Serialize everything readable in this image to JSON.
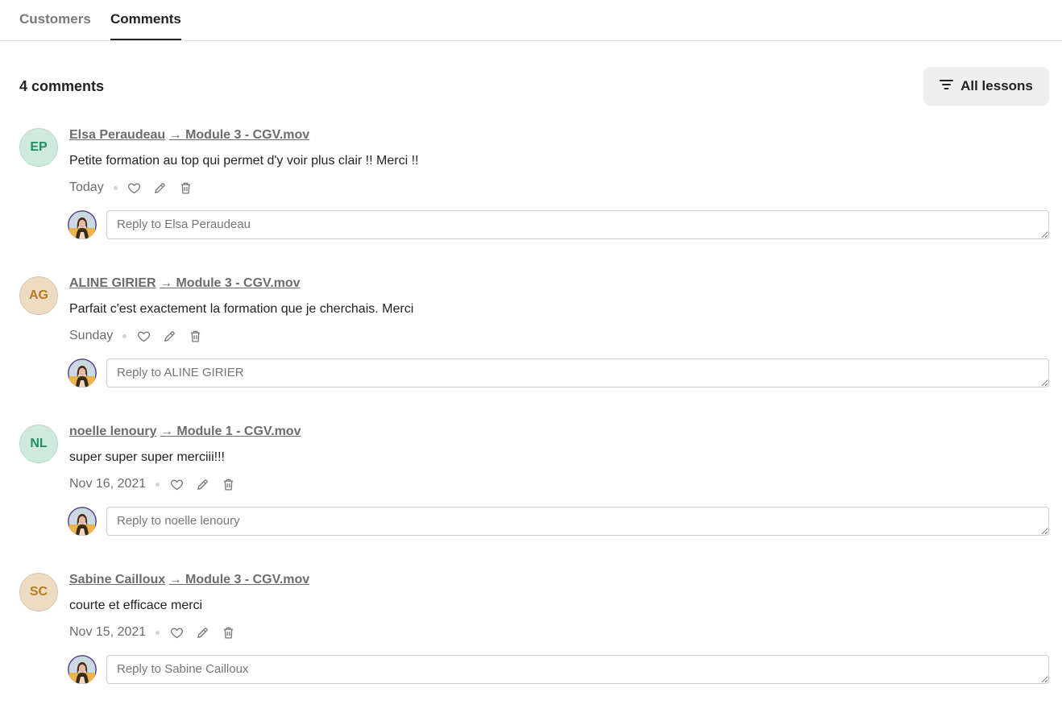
{
  "tabs": [
    {
      "label": "Customers",
      "active": false
    },
    {
      "label": "Comments",
      "active": true
    }
  ],
  "header": {
    "count_label": "4 comments",
    "filter_label": "All lessons",
    "filter_icon": "filter-lines-icon"
  },
  "colors": {
    "text_primary": "#222222",
    "text_muted": "#6c6c6c",
    "avatar_green_bg": "#cfe9dd",
    "avatar_green_text": "#1f8f5f",
    "avatar_tan_bg": "#ecdcc4",
    "avatar_tan_text": "#b67a1e",
    "filter_bg": "#efefef"
  },
  "comments": [
    {
      "initials": "EP",
      "avatar_style": "green",
      "author": "Elsa Peraudeau",
      "lesson": "→ Module 3 - CGV.mov",
      "text": "Petite formation au top qui permet d'y voir plus clair !! Merci !!",
      "date": "Today",
      "reply_placeholder": "Reply to Elsa Peraudeau"
    },
    {
      "initials": "AG",
      "avatar_style": "tan",
      "author": "ALINE GIRIER",
      "lesson": "→ Module 3 - CGV.mov",
      "text": "Parfait c'est exactement la formation que je cherchais. Merci",
      "date": "Sunday",
      "reply_placeholder": "Reply to ALINE GIRIER"
    },
    {
      "initials": "NL",
      "avatar_style": "green",
      "author": "noelle lenoury",
      "lesson": "→ Module 1 - CGV.mov",
      "text": "super super super merciii!!!",
      "date": "Nov 16, 2021",
      "reply_placeholder": "Reply to noelle lenoury"
    },
    {
      "initials": "SC",
      "avatar_style": "tan",
      "author": "Sabine Cailloux",
      "lesson": "→ Module 3 - CGV.mov",
      "text": "courte et efficace merci",
      "date": "Nov 15, 2021",
      "reply_placeholder": "Reply to Sabine Cailloux"
    }
  ],
  "icons": {
    "like": "heart-icon",
    "edit": "pencil-icon",
    "delete": "trash-icon"
  }
}
